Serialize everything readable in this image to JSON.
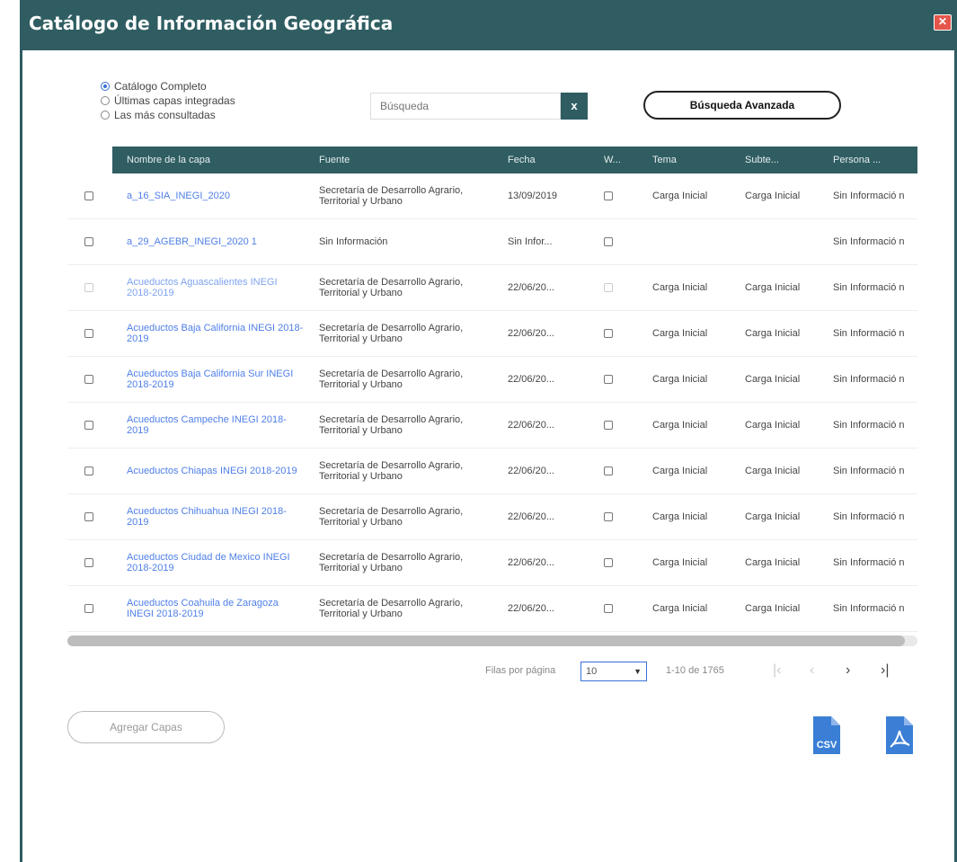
{
  "window": {
    "title": "Catálogo de Información Geográfica",
    "close_icon": "close-icon"
  },
  "filter": {
    "options": [
      {
        "label": "Catálogo Completo",
        "selected": true
      },
      {
        "label": "Últimas capas integradas",
        "selected": false
      },
      {
        "label": "Las más consultadas",
        "selected": false
      }
    ]
  },
  "search": {
    "placeholder": "Búsqueda",
    "value": "",
    "clear_label": "x"
  },
  "advanced_search_label": "Búsqueda Avanzada",
  "table": {
    "columns": [
      "Nombre de la capa",
      "Fuente",
      "Fecha",
      "W...",
      "Tema",
      "Subte...",
      "Persona ..."
    ],
    "rows": [
      {
        "name": "a_16_SIA_INEGI_2020",
        "source": "Secretaría de Desarrollo Agrario, Territorial y Urbano",
        "date": "13/09/2019",
        "theme": "Carga Inicial",
        "subtheme": "Carga Inicial",
        "person": "Sin Informació n",
        "disabled": false
      },
      {
        "name": "a_29_AGEBR_INEGI_2020 1",
        "source": "Sin Información",
        "date": "Sin Infor...",
        "theme": "",
        "subtheme": "",
        "person": "Sin Informació n",
        "disabled": false
      },
      {
        "name": "Acueductos Aguascalientes INEGI 2018-2019",
        "source": "Secretaría de Desarrollo Agrario, Territorial y Urbano",
        "date": "22/06/20...",
        "theme": "Carga Inicial",
        "subtheme": "Carga Inicial",
        "person": "Sin Informació n",
        "disabled": true
      },
      {
        "name": "Acueductos Baja California INEGI 2018-2019",
        "source": "Secretaría de Desarrollo Agrario, Territorial y Urbano",
        "date": "22/06/20...",
        "theme": "Carga Inicial",
        "subtheme": "Carga Inicial",
        "person": "Sin Informació n",
        "disabled": false
      },
      {
        "name": "Acueductos Baja California Sur INEGI 2018-2019",
        "source": "Secretaría de Desarrollo Agrario, Territorial y Urbano",
        "date": "22/06/20...",
        "theme": "Carga Inicial",
        "subtheme": "Carga Inicial",
        "person": "Sin Informació n",
        "disabled": false
      },
      {
        "name": "Acueductos Campeche INEGI 2018-2019",
        "source": "Secretaría de Desarrollo Agrario, Territorial y Urbano",
        "date": "22/06/20...",
        "theme": "Carga Inicial",
        "subtheme": "Carga Inicial",
        "person": "Sin Informació n",
        "disabled": false
      },
      {
        "name": "Acueductos Chiapas INEGI 2018-2019",
        "source": "Secretaría de Desarrollo Agrario, Territorial y Urbano",
        "date": "22/06/20...",
        "theme": "Carga Inicial",
        "subtheme": "Carga Inicial",
        "person": "Sin Informació n",
        "disabled": false
      },
      {
        "name": "Acueductos Chihuahua INEGI 2018-2019",
        "source": "Secretaría de Desarrollo Agrario, Territorial y Urbano",
        "date": "22/06/20...",
        "theme": "Carga Inicial",
        "subtheme": "Carga Inicial",
        "person": "Sin Informació n",
        "disabled": false
      },
      {
        "name": "Acueductos Ciudad de Mexico INEGI 2018-2019",
        "source": "Secretaría de Desarrollo Agrario, Territorial y Urbano",
        "date": "22/06/20...",
        "theme": "Carga Inicial",
        "subtheme": "Carga Inicial",
        "person": "Sin Informació n",
        "disabled": false
      },
      {
        "name": "Acueductos Coahuila de Zaragoza INEGI 2018-2019",
        "source": "Secretaría de Desarrollo Agrario, Territorial y Urbano",
        "date": "22/06/20...",
        "theme": "Carga Inicial",
        "subtheme": "Carga Inicial",
        "person": "Sin Informació n",
        "disabled": false
      }
    ]
  },
  "pagination": {
    "rows_per_page_label": "Filas por página",
    "rows_per_page_value": "10",
    "range_label": "1-10 de 1765",
    "first_icon": "first-page-icon",
    "prev_icon": "prev-page-icon",
    "next_icon": "next-page-icon",
    "last_icon": "last-page-icon"
  },
  "add_layers_label": "Agregar Capas",
  "export": {
    "csv_label": "CSV",
    "pdf_icon": "pdf-icon",
    "accent": "#3a7fd5"
  },
  "colors": {
    "header": "#2f5d62",
    "link": "#4f7fe8",
    "close": "#e4564b"
  }
}
